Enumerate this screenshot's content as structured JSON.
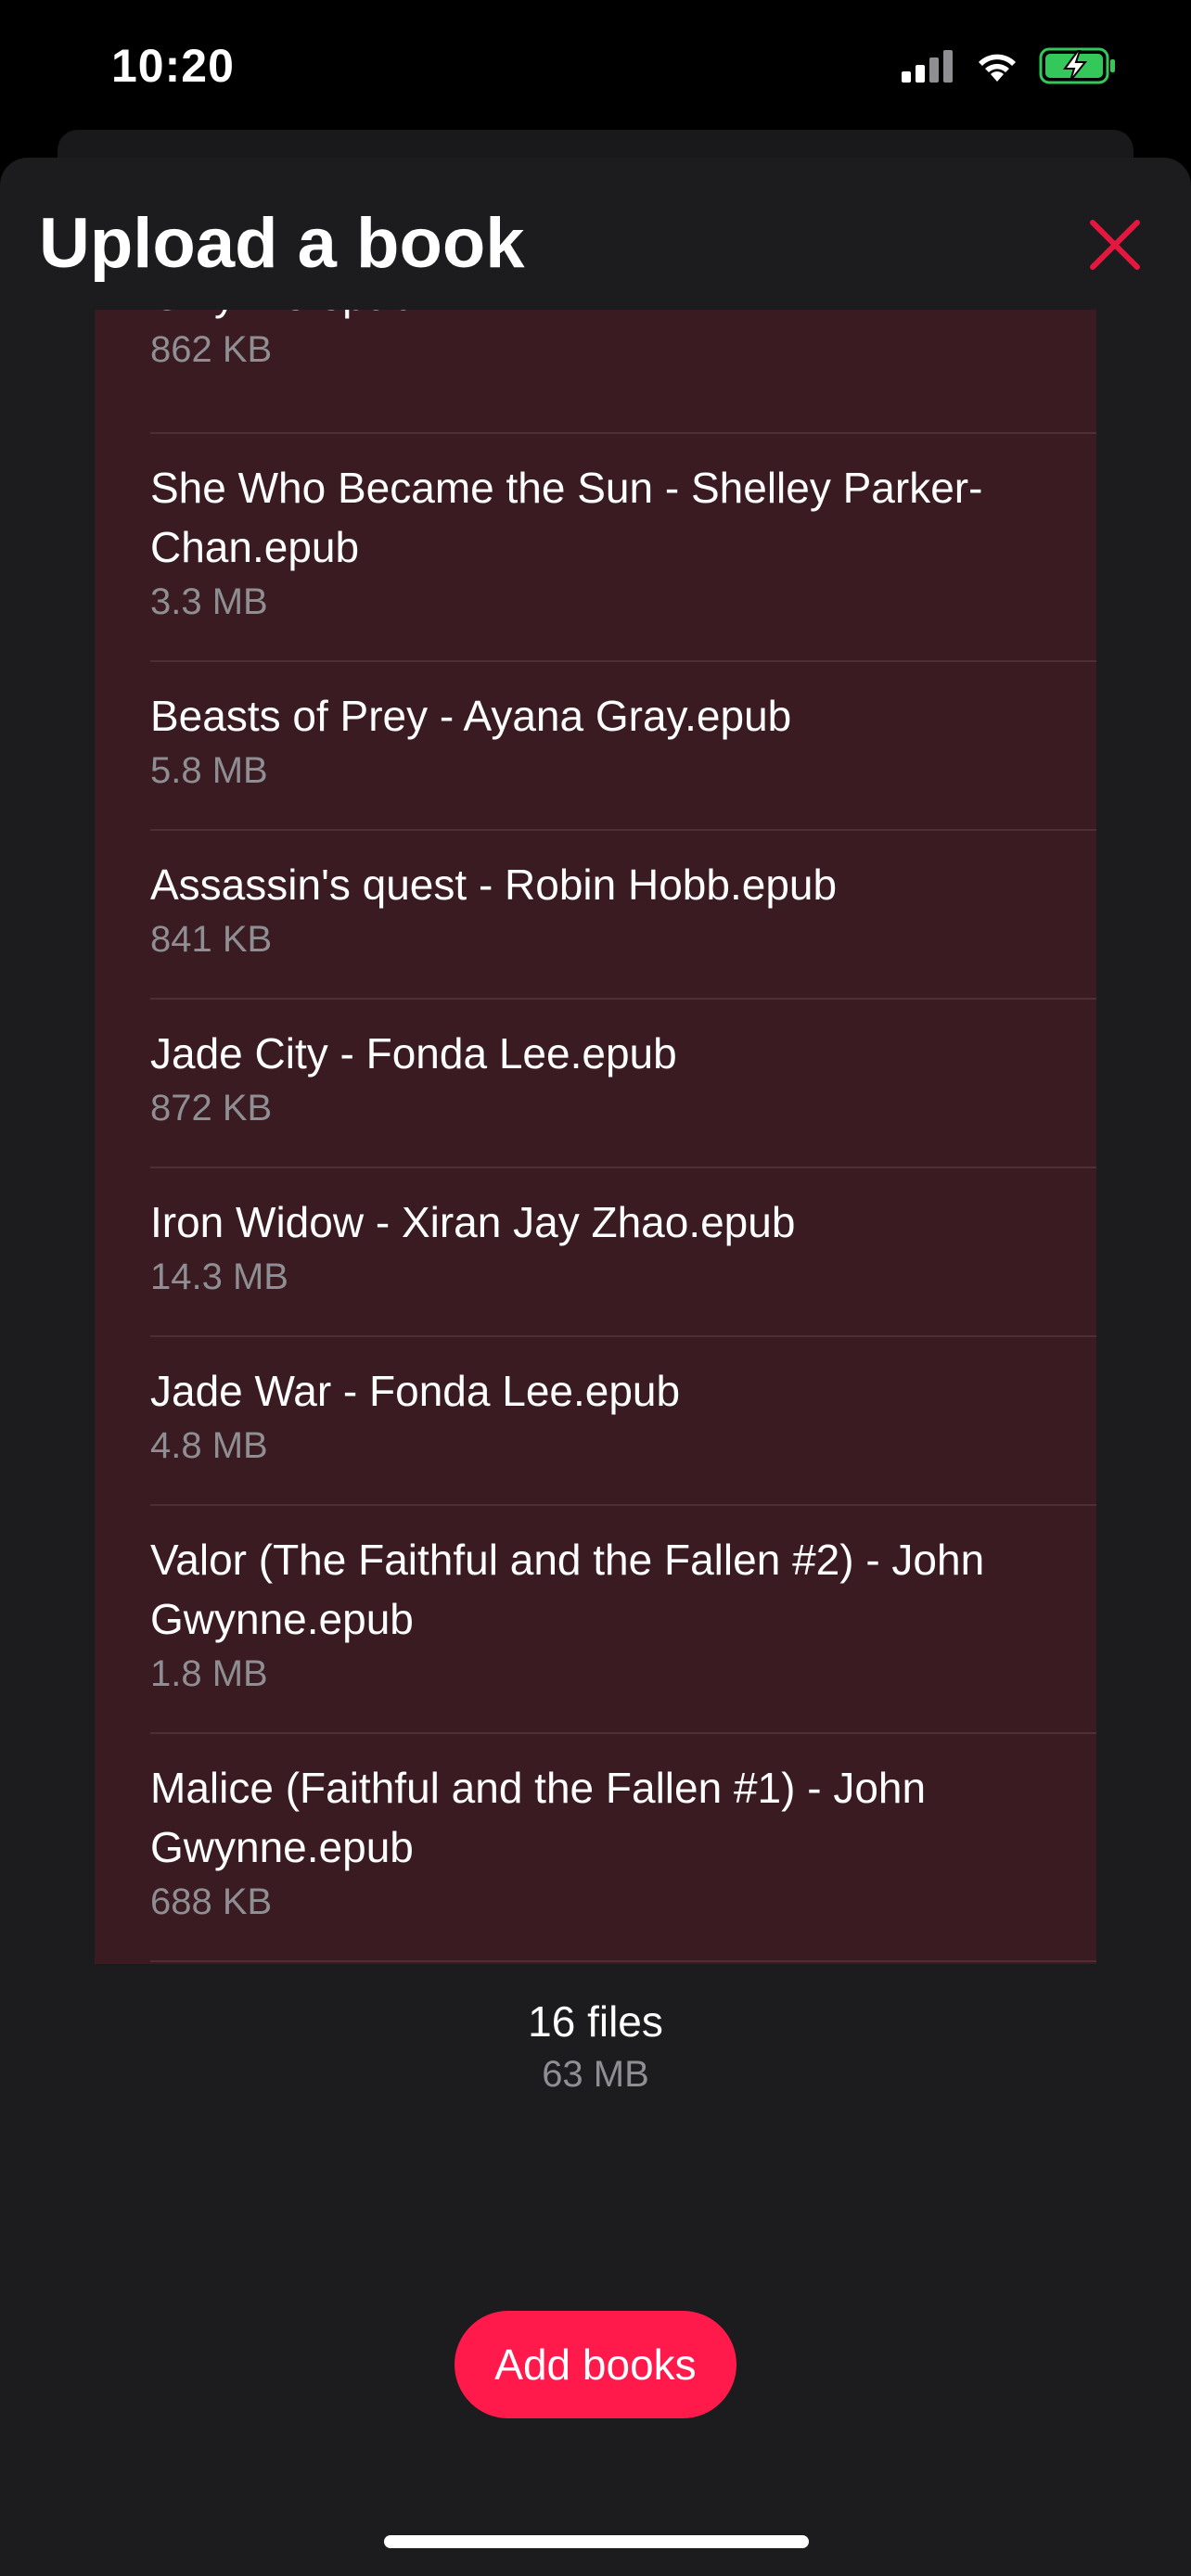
{
  "status_bar": {
    "time": "10:20",
    "signal_icon": "cellular-signal-icon",
    "wifi_icon": "wifi-icon",
    "battery_icon": "battery-charging-icon",
    "battery_color": "#34c759"
  },
  "sheet": {
    "title": "Upload a book",
    "close_icon": "close-icon",
    "accent_color": "#e5173f"
  },
  "files": [
    {
      "name": "Gwynne.epub",
      "size": "862 KB"
    },
    {
      "name": "She Who Became the Sun - Shelley Parker-Chan.epub",
      "size": "3.3 MB"
    },
    {
      "name": "Beasts of Prey - Ayana Gray.epub",
      "size": "5.8 MB"
    },
    {
      "name": "Assassin's quest - Robin Hobb.epub",
      "size": "841 KB"
    },
    {
      "name": "Jade City - Fonda Lee.epub",
      "size": "872 KB"
    },
    {
      "name": "Iron Widow - Xiran Jay Zhao.epub",
      "size": "14.3 MB"
    },
    {
      "name": "Jade War - Fonda Lee.epub",
      "size": "4.8 MB"
    },
    {
      "name": "Valor (The Faithful and the Fallen #2) - John Gwynne.epub",
      "size": "1.8 MB"
    },
    {
      "name": "Malice (Faithful and the Fallen #1) - John Gwynne.epub",
      "size": "688 KB"
    }
  ],
  "summary": {
    "count": "16 files",
    "total_size": "63 MB"
  },
  "actions": {
    "add_label": "Add books",
    "add_color": "#ff1a4b"
  }
}
